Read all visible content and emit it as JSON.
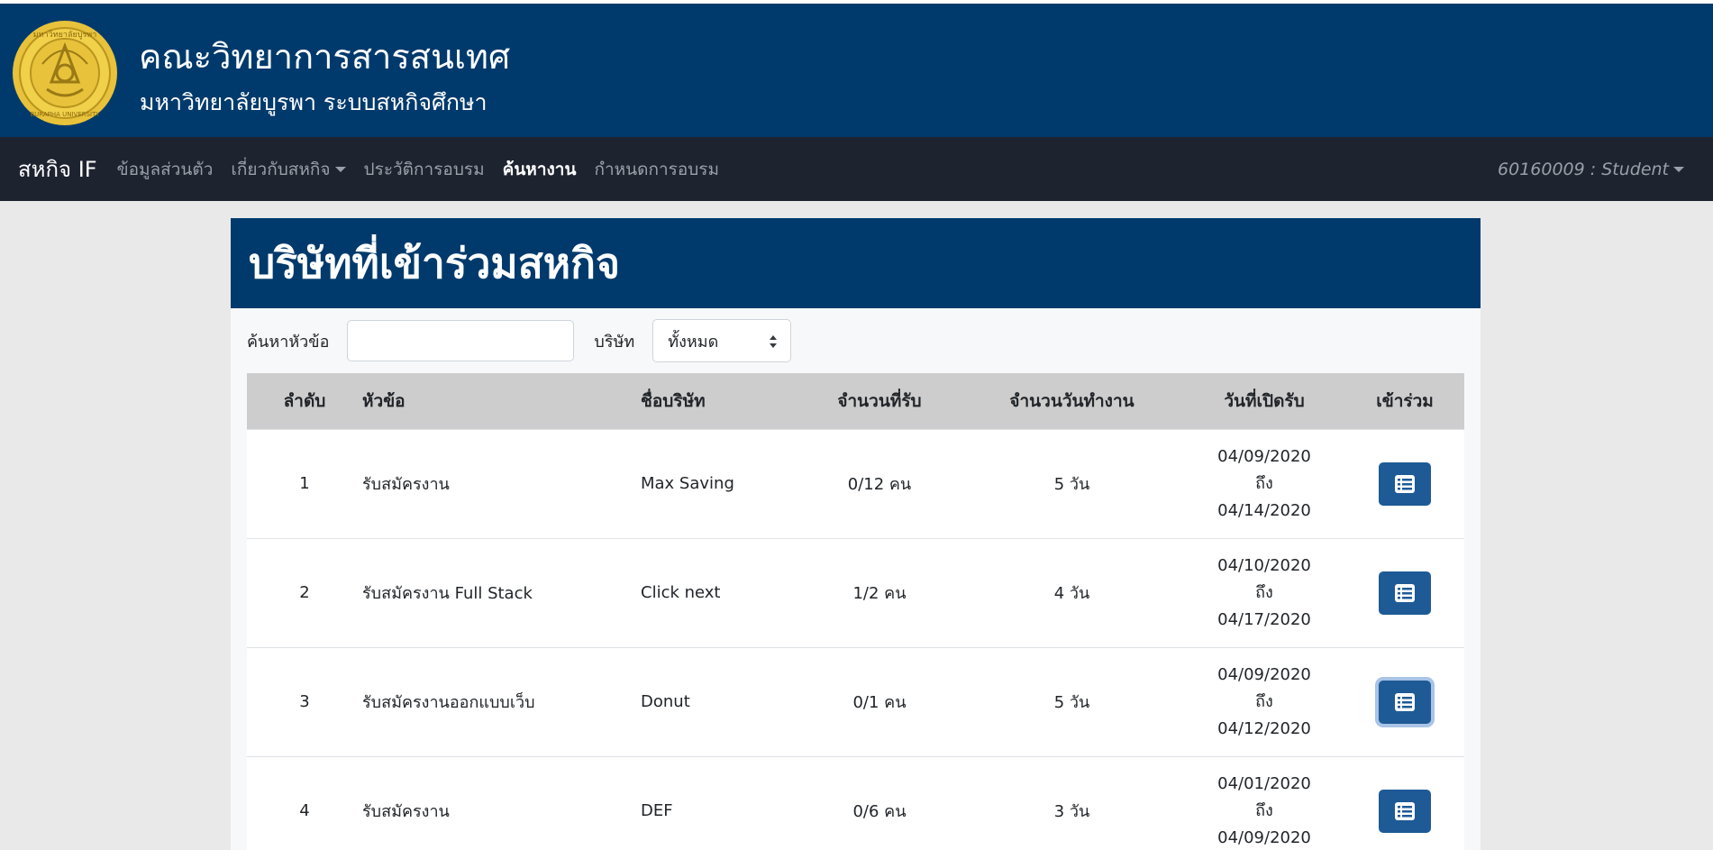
{
  "banner": {
    "title": "คณะวิทยาการสารสนเทศ",
    "subtitle": "มหาวิทยาลัยบูรพา ระบบสหกิจศึกษา",
    "logo_icon": "burapha-university-seal",
    "logo_text_top": "มหาวิทยาลัยบูรพา",
    "logo_text_bottom": "BURAPHA UNIVERSITY"
  },
  "navbar": {
    "brand": "สหกิจ IF",
    "items": [
      {
        "label": "ข้อมูลส่วนตัว",
        "active": false
      },
      {
        "label": "เกี่ยวกับสหกิจ",
        "active": false,
        "dropdown": true
      },
      {
        "label": "ประวัติการอบรม",
        "active": false
      },
      {
        "label": "ค้นหางาน",
        "active": true
      },
      {
        "label": "กำหนดการอบรม",
        "active": false
      }
    ],
    "user": "60160009 : Student"
  },
  "page": {
    "heading": "บริษัทที่เข้าร่วมสหกิจ",
    "search_label": "ค้นหาหัวข้อ",
    "search_value": "",
    "company_label": "บริษัท",
    "company_selected": "ทั้งหมด"
  },
  "table": {
    "headers": [
      "ลำดับ",
      "หัวข้อ",
      "ชื่อบริษัท",
      "จำนวนที่รับ",
      "จำนวนวันทำงาน",
      "วันที่เปิดรับ",
      "เข้าร่วม"
    ],
    "rows": [
      {
        "index": "1",
        "topic": "รับสมัครงาน",
        "company": "Max Saving",
        "count": "0/12 คน",
        "days": "5 วัน",
        "start": "04/09/2020",
        "to": "ถึง",
        "end": "04/14/2020",
        "focused": false
      },
      {
        "index": "2",
        "topic": "รับสมัครงาน Full Stack",
        "company": "Click next",
        "count": "1/2 คน",
        "days": "4 วัน",
        "start": "04/10/2020",
        "to": "ถึง",
        "end": "04/17/2020",
        "focused": false
      },
      {
        "index": "3",
        "topic": "รับสมัครงานออกแบบเว็บ",
        "company": "Donut",
        "count": "0/1 คน",
        "days": "5 วัน",
        "start": "04/09/2020",
        "to": "ถึง",
        "end": "04/12/2020",
        "focused": true
      },
      {
        "index": "4",
        "topic": "รับสมัครงาน",
        "company": "DEF",
        "count": "0/6 คน",
        "days": "3 วัน",
        "start": "04/01/2020",
        "to": "ถึง",
        "end": "04/09/2020",
        "focused": false
      }
    ],
    "join_icon": "list-icon"
  },
  "colors": {
    "banner": "#003a6c",
    "navbar": "#1e2330",
    "join_button": "#1e5a96",
    "seal_gold": "#e8c23a"
  }
}
